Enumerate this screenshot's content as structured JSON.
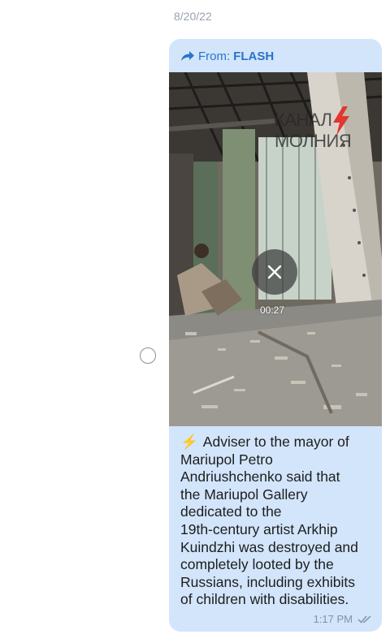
{
  "date_separator": "8/20/22",
  "message": {
    "forward_prefix": "From:",
    "forward_source": "FLASH",
    "video": {
      "duration": "00:27",
      "watermark_line1": "КАНАЛ",
      "watermark_line2": "МОЛНИЯ"
    },
    "emoji": "⚡",
    "text": "Adviser to the mayor of\nMariupol Petro\nAndriushchenko said that\nthe Mariupol Gallery\ndedicated to the\n19th-century artist Arkhip\nKuindzhi was destroyed and\ncompletely looted by the\nRussians, including exhibits\nof children with disabilities.",
    "time": "1:17 PM",
    "status": "read"
  },
  "colors": {
    "bubble": "#d2e5fb",
    "link": "#2a73c8",
    "meta": "#7e93a6",
    "date": "#9aa3ad"
  },
  "icons": {
    "forward": "forward-arrow-icon",
    "play": "close-x-icon",
    "checks": "double-check-icon",
    "bolt": "lightning-icon"
  }
}
